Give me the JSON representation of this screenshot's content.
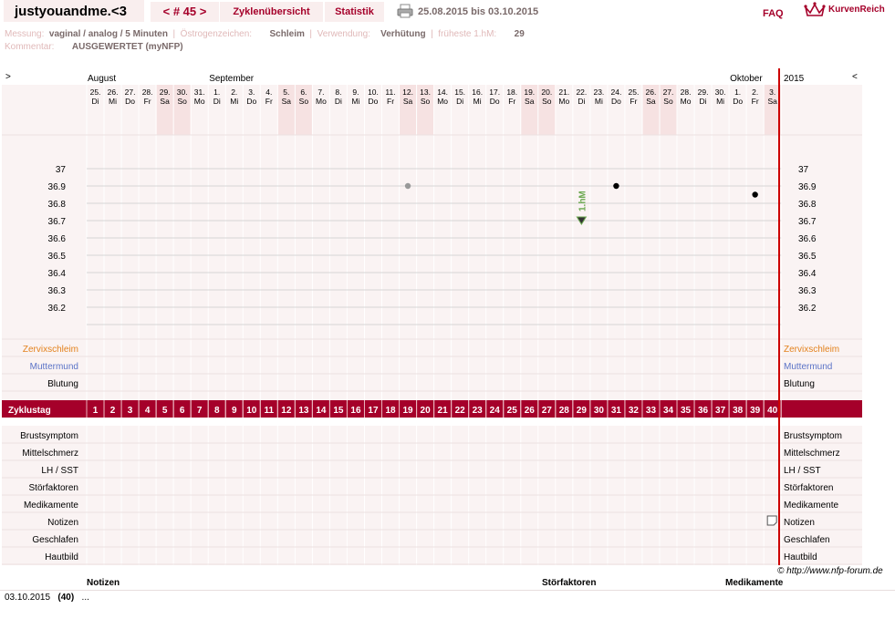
{
  "header": {
    "username": "justyouandme.<3",
    "cycle_prev": "<",
    "cycle_label": "# 45",
    "cycle_next": ">",
    "tab_overview": "Zyklenübersicht",
    "tab_stats": "Statistik",
    "print_icon": "printer-icon",
    "date_range": "25.08.2015 bis 03.10.2015",
    "faq": "FAQ",
    "brand": "KurvenReich",
    "brand_icon": "crown-icon"
  },
  "info": {
    "messung_label": "Messung:",
    "messung_value": "vaginal / analog / 5 Minuten",
    "oestrogen_label": "Östrogenzeichen:",
    "oestrogen_value": "Schleim",
    "verwendung_label": "Verwendung:",
    "verwendung_value": "Verhütung",
    "fhm_label": "früheste 1.hM:",
    "fhm_value": "29",
    "kommentar_label": "Kommentar:",
    "kommentar_value": "AUSGEWERTET (myNFP)"
  },
  "chart": {
    "collapse_left": ">",
    "collapse_right": "<",
    "months": [
      {
        "name": "August",
        "day_index": 0
      },
      {
        "name": "September",
        "day_index": 7
      },
      {
        "name": "Oktober",
        "day_index": 37
      }
    ],
    "year": "2015",
    "days": [
      {
        "d": "25.",
        "w": "Di",
        "we": false
      },
      {
        "d": "26.",
        "w": "Mi",
        "we": false
      },
      {
        "d": "27.",
        "w": "Do",
        "we": false
      },
      {
        "d": "28.",
        "w": "Fr",
        "we": false
      },
      {
        "d": "29.",
        "w": "Sa",
        "we": true
      },
      {
        "d": "30.",
        "w": "So",
        "we": true
      },
      {
        "d": "31.",
        "w": "Mo",
        "we": false
      },
      {
        "d": "1.",
        "w": "Di",
        "we": false
      },
      {
        "d": "2.",
        "w": "Mi",
        "we": false
      },
      {
        "d": "3.",
        "w": "Do",
        "we": false
      },
      {
        "d": "4.",
        "w": "Fr",
        "we": false
      },
      {
        "d": "5.",
        "w": "Sa",
        "we": true
      },
      {
        "d": "6.",
        "w": "So",
        "we": true
      },
      {
        "d": "7.",
        "w": "Mo",
        "we": false
      },
      {
        "d": "8.",
        "w": "Di",
        "we": false
      },
      {
        "d": "9.",
        "w": "Mi",
        "we": false
      },
      {
        "d": "10.",
        "w": "Do",
        "we": false
      },
      {
        "d": "11.",
        "w": "Fr",
        "we": false
      },
      {
        "d": "12.",
        "w": "Sa",
        "we": true
      },
      {
        "d": "13.",
        "w": "So",
        "we": true
      },
      {
        "d": "14.",
        "w": "Mo",
        "we": false
      },
      {
        "d": "15.",
        "w": "Di",
        "we": false
      },
      {
        "d": "16.",
        "w": "Mi",
        "we": false
      },
      {
        "d": "17.",
        "w": "Do",
        "we": false
      },
      {
        "d": "18.",
        "w": "Fr",
        "we": false
      },
      {
        "d": "19.",
        "w": "Sa",
        "we": true
      },
      {
        "d": "20.",
        "w": "So",
        "we": true
      },
      {
        "d": "21.",
        "w": "Mo",
        "we": false
      },
      {
        "d": "22.",
        "w": "Di",
        "we": false
      },
      {
        "d": "23.",
        "w": "Mi",
        "we": false
      },
      {
        "d": "24.",
        "w": "Do",
        "we": false
      },
      {
        "d": "25.",
        "w": "Fr",
        "we": false
      },
      {
        "d": "26.",
        "w": "Sa",
        "we": true
      },
      {
        "d": "27.",
        "w": "So",
        "we": true
      },
      {
        "d": "28.",
        "w": "Mo",
        "we": false
      },
      {
        "d": "29.",
        "w": "Di",
        "we": false
      },
      {
        "d": "30.",
        "w": "Mi",
        "we": false
      },
      {
        "d": "1.",
        "w": "Do",
        "we": false
      },
      {
        "d": "2.",
        "w": "Fr",
        "we": false
      },
      {
        "d": "3.",
        "w": "Sa",
        "we": true
      }
    ],
    "temp_ticks": [
      "37",
      "36.9",
      "36.8",
      "36.7",
      "36.6",
      "36.5",
      "36.4",
      "36.3",
      "36.2"
    ],
    "temp_points": [
      {
        "cycle_day": 19,
        "value": 36.9,
        "color": "#999999"
      },
      {
        "cycle_day": 31,
        "value": 36.9,
        "color": "#000000"
      },
      {
        "cycle_day": 39,
        "value": 36.85,
        "color": "#000000"
      }
    ],
    "marker": {
      "label": "1.hM",
      "cycle_day": 29,
      "value": 36.7,
      "color": "#6aa84f"
    },
    "sign_rows": [
      {
        "label": "Zervixschleim",
        "color": "#e3821d"
      },
      {
        "label": "Muttermund",
        "color": "#5b73c7"
      },
      {
        "label": "Blutung",
        "color": "#000000"
      }
    ],
    "cycle_day_label": "Zyklustag",
    "cycle_days": [
      "1",
      "2",
      "3",
      "4",
      "5",
      "6",
      "7",
      "8",
      "9",
      "10",
      "11",
      "12",
      "13",
      "14",
      "15",
      "16",
      "17",
      "18",
      "19",
      "20",
      "21",
      "22",
      "23",
      "24",
      "25",
      "26",
      "27",
      "28",
      "29",
      "30",
      "31",
      "32",
      "33",
      "34",
      "35",
      "36",
      "37",
      "38",
      "39",
      "40"
    ],
    "extra_rows": [
      "Brustsymptom",
      "Mittelschmerz",
      "LH / SST",
      "Störfaktoren",
      "Medikamente",
      "Notizen",
      "Geschlafen",
      "Hautbild"
    ],
    "note_icon": {
      "row": "Notizen",
      "cycle_day": 40,
      "name": "note-icon"
    }
  },
  "copyright": "© http://www.nfp-forum.de",
  "footer": {
    "col_notes": "Notizen",
    "col_stoer": "Störfaktoren",
    "col_medi": "Medikamente",
    "entry_date": "03.10.2015",
    "entry_day": "(40)",
    "entry_note": "..."
  }
}
